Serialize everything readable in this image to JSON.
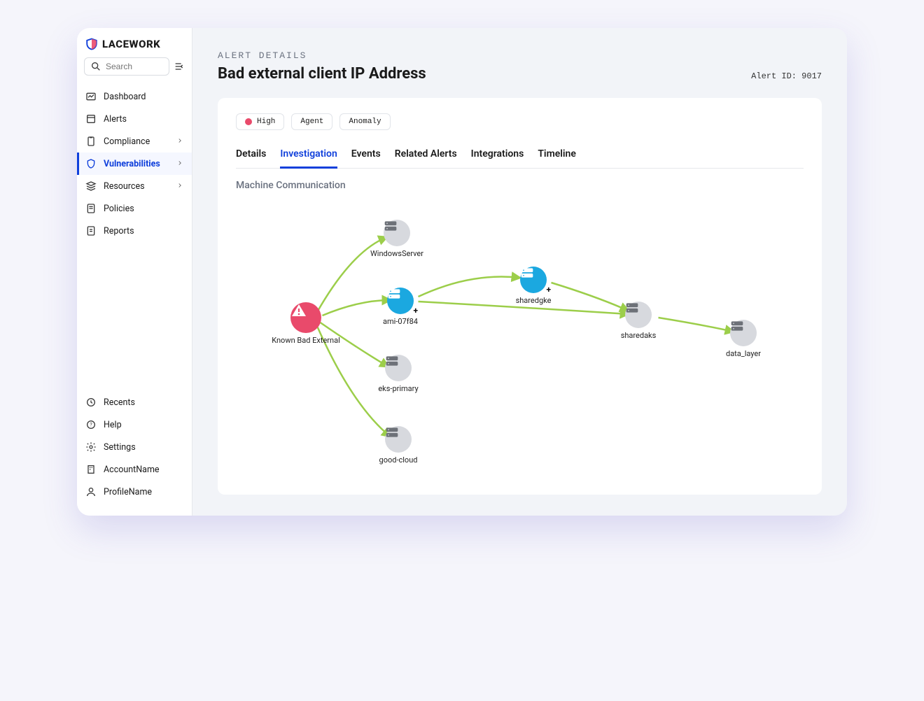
{
  "brand": "LACEWORK",
  "search": {
    "placeholder": "Search"
  },
  "nav": {
    "dashboard": "Dashboard",
    "alerts": "Alerts",
    "compliance": "Compliance",
    "vulnerabilities": "Vulnerabilities",
    "resources": "Resources",
    "policies": "Policies",
    "reports": "Reports"
  },
  "bottomNav": {
    "recents": "Recents",
    "help": "Help",
    "settings": "Settings",
    "account": "AccountName",
    "profile": "ProfileName"
  },
  "header": {
    "crumb": "ALERT DETAILS",
    "title": "Bad external client IP Address",
    "alert_id_label": "Alert ID: 9017"
  },
  "chips": {
    "severity": "High",
    "source": "Agent",
    "type": "Anomaly"
  },
  "tabs": {
    "details": "Details",
    "investigation": "Investigation",
    "events": "Events",
    "related": "Related Alerts",
    "integrations": "Integrations",
    "timeline": "Timeline"
  },
  "section": {
    "title": "Machine Communication"
  },
  "graph": {
    "known_bad": "Known Bad External",
    "windows": "WindowsServer",
    "ami": "ami-07f84",
    "eks": "eks-primary",
    "good": "good-cloud",
    "sharedgke": "sharedgke",
    "sharedaks": "sharedaks",
    "data_layer": "data_layer"
  },
  "colors": {
    "accent": "#0f3fdb",
    "danger": "#e94a6b",
    "edge": "#9cce4a",
    "node_highlight": "#1ba8e0"
  }
}
